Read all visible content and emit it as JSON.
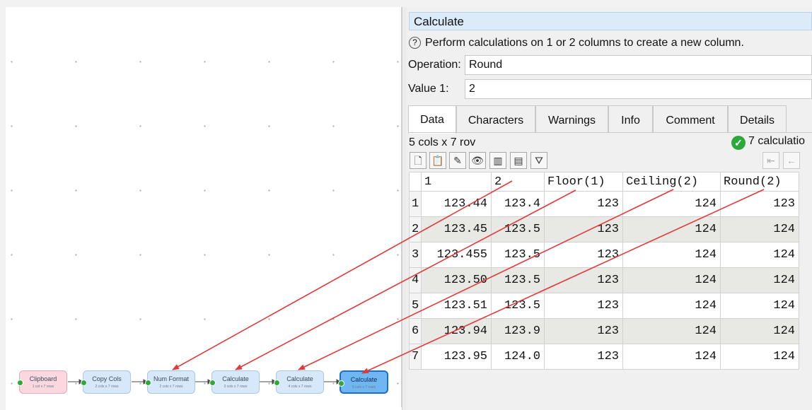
{
  "canvas": {
    "nodes": [
      {
        "title": "Clipboard",
        "sub": "1 col x 7 rows"
      },
      {
        "title": "Copy Cols",
        "sub": "2 cols x 7 rows"
      },
      {
        "title": "Num Format",
        "sub": "2 cols x 7 rows"
      },
      {
        "title": "Calculate",
        "sub": "3 cols x 7 rows"
      },
      {
        "title": "Calculate",
        "sub": "4 cols x 7 rows"
      },
      {
        "title": "Calculate",
        "sub": "5 cols x 7 rows"
      }
    ]
  },
  "panel": {
    "title": "Calculate",
    "help_icon": "?",
    "description": "Perform calculations on 1 or 2 columns to create a new column.",
    "operation_label": "Operation:",
    "operation_value": "Round",
    "value1_label": "Value 1:",
    "value1_value": "2",
    "tabs": [
      "Data",
      "Characters",
      "Warnings",
      "Info",
      "Comment",
      "Details"
    ],
    "active_tab": "Data",
    "dims": "5 cols x 7 rov",
    "calc_status": "7 calculatio",
    "status_color": "#2da83a"
  },
  "toolbar": {
    "icons": [
      "new-document-icon",
      "paste-icon",
      "pencil-icon",
      "eye-icon",
      "columns-icon",
      "rows-icon",
      "filter-icon"
    ],
    "nav_icons": [
      "first-page-icon",
      "previous-page-icon"
    ]
  },
  "grid": {
    "headers": [
      "1",
      "2",
      "Floor(1)",
      "Ceiling(2)",
      "Round(2)"
    ],
    "rows": [
      [
        "1",
        "123.44",
        "123.4",
        "123",
        "124",
        "123"
      ],
      [
        "2",
        "123.45",
        "123.5",
        "123",
        "124",
        "124"
      ],
      [
        "3",
        "123.455",
        "123.5",
        "123",
        "124",
        "124"
      ],
      [
        "4",
        "123.50",
        "123.5",
        "123",
        "124",
        "124"
      ],
      [
        "5",
        "123.51",
        "123.5",
        "123",
        "124",
        "124"
      ],
      [
        "6",
        "123.94",
        "123.9",
        "123",
        "124",
        "124"
      ],
      [
        "7",
        "123.95",
        "124.0",
        "123",
        "124",
        "124"
      ]
    ]
  },
  "colors": {
    "arrow": "#e23a3a",
    "selected_node": "#6fb6f3",
    "clipboard_node": "#fbd7e0",
    "node": "#d7e8fb"
  }
}
